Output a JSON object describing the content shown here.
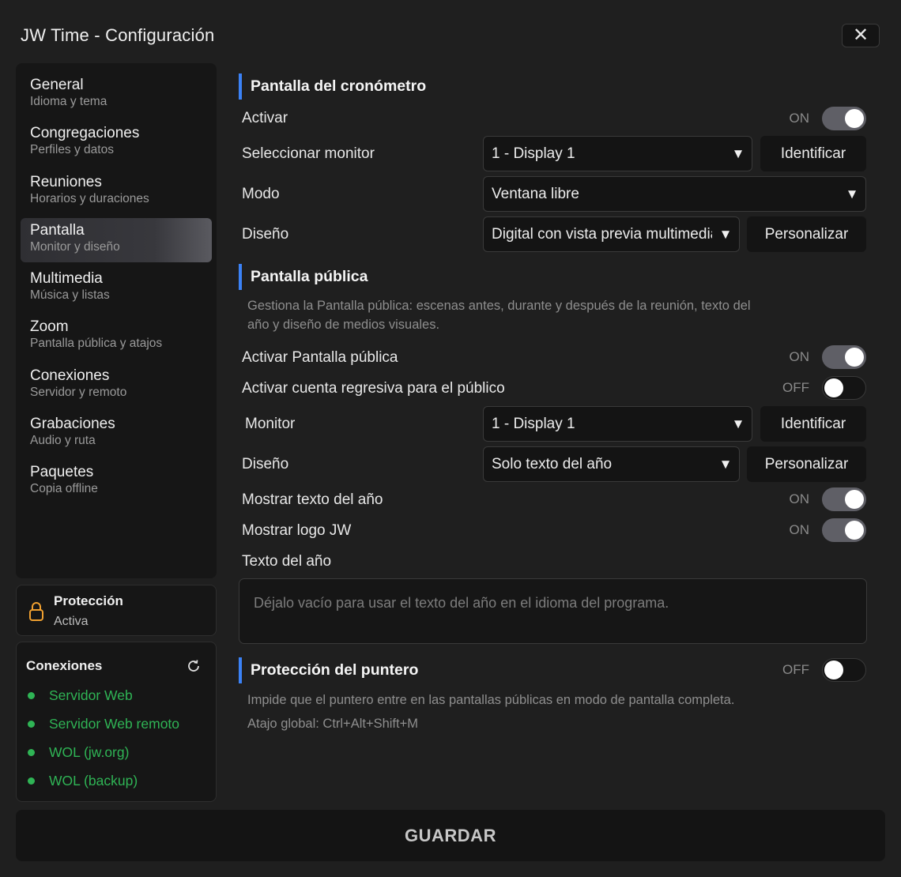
{
  "window": {
    "title": "JW Time - Configuración",
    "close_symbol": "✕"
  },
  "nav": {
    "items": [
      {
        "label": "General",
        "sub": "Idioma y tema"
      },
      {
        "label": "Congregaciones",
        "sub": "Perfiles y datos"
      },
      {
        "label": "Reuniones",
        "sub": "Horarios y duraciones"
      },
      {
        "label": "Pantalla",
        "sub": "Monitor y diseño",
        "active": true
      },
      {
        "label": "Multimedia",
        "sub": "Música y listas"
      },
      {
        "label": "Zoom",
        "sub": "Pantalla pública y atajos"
      },
      {
        "label": "Conexiones",
        "sub": "Servidor y remoto"
      },
      {
        "label": "Grabaciones",
        "sub": "Audio y ruta"
      },
      {
        "label": "Paquetes",
        "sub": "Copia offline"
      }
    ]
  },
  "protection_card": {
    "title": "Protección",
    "status": "Activa",
    "icon": "lock-icon",
    "icon_color": "#f0a030"
  },
  "connections_card": {
    "title": "Conexiones",
    "refresh_icon": "refresh-icon",
    "status_color": "#2fb455",
    "items": [
      "Servidor Web",
      "Servidor Web remoto",
      "WOL (jw.org)",
      "WOL (backup)"
    ]
  },
  "stopwatch_screen": {
    "heading": "Pantalla del cronómetro",
    "activate": {
      "label": "Activar",
      "state": "ON"
    },
    "monitor": {
      "label": "Seleccionar monitor",
      "value": "1 - Display 1",
      "button": "Identificar"
    },
    "mode": {
      "label": "Modo",
      "value": "Ventana libre"
    },
    "design": {
      "label": "Diseño",
      "value": "Digital con vista previa multimedia",
      "button": "Personalizar"
    }
  },
  "public_screen": {
    "heading": "Pantalla pública",
    "description_line1": "Gestiona la Pantalla pública: escenas antes, durante y después de la reunión, texto del",
    "description_line2": "año y diseño de medios visuales.",
    "activate_public": {
      "label": "Activar Pantalla pública",
      "state": "ON"
    },
    "countdown": {
      "label": "Activar cuenta regresiva para el público",
      "state": "OFF"
    },
    "monitor": {
      "label": "Monitor",
      "value": "1 - Display 1",
      "button": "Identificar"
    },
    "design": {
      "label": "Diseño",
      "value": "Solo texto del año",
      "button": "Personalizar"
    },
    "show_year_text": {
      "label": "Mostrar texto del año",
      "state": "ON"
    },
    "show_logo": {
      "label": "Mostrar logo JW",
      "state": "ON"
    },
    "year_text": {
      "label": "Texto del año",
      "placeholder": "Déjalo vacío para usar el texto del año en el idioma del programa."
    }
  },
  "pointer_protection": {
    "heading": "Protección del puntero",
    "state": "OFF",
    "description": "Impide que el puntero entre en las pantallas públicas en modo de pantalla completa.",
    "shortcut": "Atajo global: Ctrl+Alt+Shift+M"
  },
  "footer": {
    "save_label": "GUARDAR"
  },
  "colors": {
    "accent": "#3b82f6",
    "background": "#1f1f1f",
    "panel": "#161616"
  },
  "caret_symbol": "▼"
}
